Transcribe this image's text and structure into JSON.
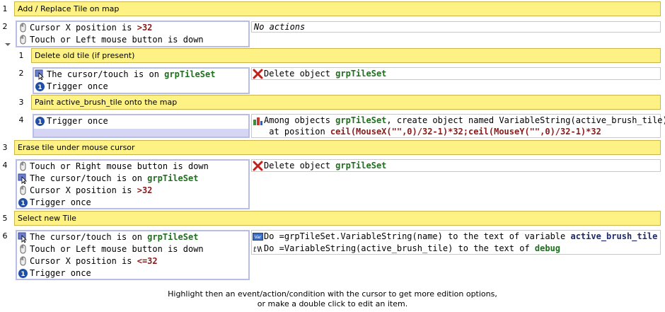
{
  "events": {
    "e1": {
      "num": "1",
      "comment": "Add / Replace Tile on map"
    },
    "e2": {
      "num": "2",
      "cond1_a": "Cursor X position is ",
      "cond1_b": ">32",
      "cond2": "Touch or Left mouse button is down",
      "action": "No actions"
    },
    "s1": {
      "num": "1",
      "comment": "Delete old tile (if present)"
    },
    "s2": {
      "num": "2",
      "cond1_a": "The cursor/touch is on ",
      "cond1_b": "grpTileSet",
      "cond2": "Trigger once",
      "act_a": "Delete object ",
      "act_b": "grpTileSet"
    },
    "s3": {
      "num": "3",
      "comment": "Paint active_brush_tile onto the map"
    },
    "s4": {
      "num": "4",
      "cond1": "Trigger once",
      "act1_a": "Among objects ",
      "act1_b": "grpTileSet",
      "act1_c": ", create object named VariableString(active_brush_tile)",
      "act2_a": " at position ",
      "act2_b": "ceil(MouseX(\"\",0)/32-1)*32;ceil(MouseY(\"\",0)/32-1)*32"
    },
    "e3": {
      "num": "3",
      "comment": "Erase tile under mouse cursor"
    },
    "e4": {
      "num": "4",
      "cond1": "Touch or Right mouse button is down",
      "cond2_a": "The cursor/touch is on ",
      "cond2_b": "grpTileSet",
      "cond3_a": "Cursor X position is ",
      "cond3_b": ">32",
      "cond4": "Trigger once",
      "act_a": "Delete object ",
      "act_b": "grpTileSet"
    },
    "e5": {
      "num": "5",
      "comment": "Select new Tile"
    },
    "e6": {
      "num": "6",
      "cond1_a": "The cursor/touch is on ",
      "cond1_b": "grpTileSet",
      "cond2": "Touch or Left mouse button is down",
      "cond3_a": "Cursor X position is ",
      "cond3_b": "<=32",
      "cond4": "Trigger once",
      "act1_a": "Do =grpTileSet.VariableString(name) to the text of variable ",
      "act1_b": "active_brush_tile",
      "act2_a": "Do =VariableString(active_brush_tile) to the text of ",
      "act2_b": "debug"
    }
  },
  "footer": {
    "line1": "Highlight then an event/action/condition with the cursor to get more edition options,",
    "line2": "or make a double click to edit an item."
  },
  "icons": {
    "mouse": "mouse-icon",
    "cursor_on": "cursor-on-object-icon",
    "trigger_once": "trigger-once-icon",
    "delete": "delete-object-icon",
    "create": "create-object-icon",
    "variable": "variable-icon",
    "text": "text-icon",
    "collapse": "collapse-arrow-icon"
  },
  "colors": {
    "comment_bg": "#fdf283",
    "object": "#1e6f1e",
    "value": "#8a1b1b",
    "condition_border": "#b8bde6"
  }
}
